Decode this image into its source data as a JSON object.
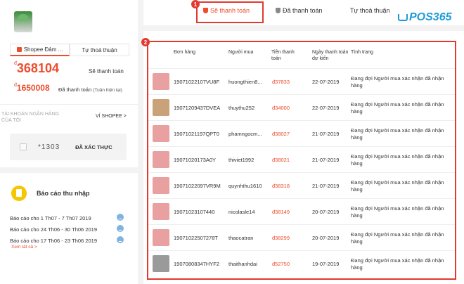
{
  "colors": {
    "accent": "#ee4d2d",
    "annotation": "#e23a2e",
    "logo": "#1f9cd8"
  },
  "left": {
    "tab_shopee": "Shopee Đảm ...",
    "tab_agreement": "Tự thoả thuận",
    "amount_pending": "368104",
    "amount_pending_currency": "đ",
    "amount_pending_label": "Sẽ thanh toán",
    "amount_paid": "1650008",
    "amount_paid_currency": "đ",
    "amount_paid_label": "Đã thanh toán",
    "amount_paid_note": "(Tuần hiện tại)",
    "bank_title": "TÀI KHOẢN NGÂN HÀNG CỦA TÔI",
    "wallet_link": "VÍ SHOPEE >",
    "card_number": "*1303",
    "card_status": "ĐÃ XÁC THỰC"
  },
  "reports": {
    "title": "Báo cáo thu nhập",
    "items": [
      "Báo cáo cho 1 Th07 - 7 Th07 2019",
      "Báo cáo cho 24 Th06 - 30 Th06 2019",
      "Báo cáo cho 17 Th06 - 23 Th06 2019"
    ],
    "see_all": "Xem tất cả >"
  },
  "tabs": {
    "pending": "Sẽ thanh toán",
    "paid": "Đã thanh toán",
    "agreement": "Tự thoả thuận"
  },
  "badges": {
    "one": "1",
    "two": "2"
  },
  "logo": {
    "text": "POS365"
  },
  "table": {
    "headers": {
      "order": "Đơn hàng",
      "buyer": "Người mua",
      "amount": "Tiền thanh toán",
      "date": "Ngày thanh toán dự kiến",
      "status": "Tình trạng"
    },
    "rows": [
      {
        "code": "19071022107VU8F",
        "buyer": "huongthien8...",
        "amount": "đ37833",
        "date": "22-07-2019",
        "status": "Đang đợi Người mua xác nhận đã nhận hàng",
        "thumb": "red"
      },
      {
        "code": "19071209437DVEA",
        "buyer": "thuythu252",
        "amount": "đ34000",
        "date": "22-07-2019",
        "status": "Đang đợi Người mua xác nhận đã nhận hàng",
        "thumb": "brown"
      },
      {
        "code": "19071021197QPT0",
        "buyer": "phamngocm...",
        "amount": "đ38027",
        "date": "21-07-2019",
        "status": "Đang đợi Người mua xác nhận đã nhận hàng",
        "thumb": "red"
      },
      {
        "code": "19071020173A0Y",
        "buyer": "thiviet1992",
        "amount": "đ38021",
        "date": "21-07-2019",
        "status": "Đang đợi Người mua xác nhận đã nhận hàng",
        "thumb": "red"
      },
      {
        "code": "19071022097VR9M",
        "buyer": "quynhthu1610",
        "amount": "đ38318",
        "date": "21-07-2019",
        "status": "Đang đợi Người mua xác nhận đã nhận hàng",
        "thumb": "red"
      },
      {
        "code": "19071023107440",
        "buyer": "nicolasle14",
        "amount": "đ38149",
        "date": "20-07-2019",
        "status": "Đang đợi Người mua xác nhận đã nhận hàng",
        "thumb": "red"
      },
      {
        "code": "19071022507278T",
        "buyer": "thaocatran",
        "amount": "đ38299",
        "date": "20-07-2019",
        "status": "Đang đợi Người mua xác nhận đã nhận hàng",
        "thumb": "red"
      },
      {
        "code": "19070808347HYF2",
        "buyer": "thaithanhdai",
        "amount": "đ52750",
        "date": "19-07-2019",
        "status": "Đang đợi Người mua xác nhận đã nhận hàng",
        "thumb": "grey"
      }
    ]
  }
}
